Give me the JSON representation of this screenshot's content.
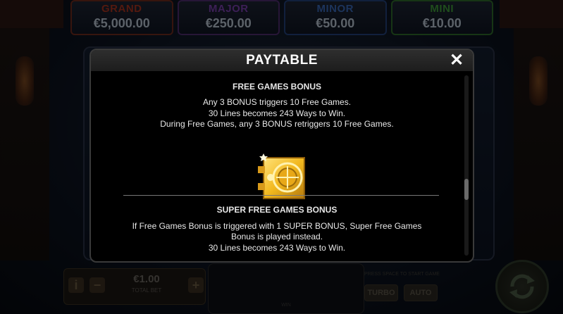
{
  "jackpots": {
    "grand": {
      "name": "GRAND",
      "value": "€5,000.00"
    },
    "major": {
      "name": "MAJOR",
      "value": "€250.00"
    },
    "minor": {
      "name": "MINOR",
      "value": "€50.00"
    },
    "mini": {
      "name": "MINI",
      "value": "€10.00"
    }
  },
  "bottom_bar": {
    "info_symbol": "i",
    "minus_symbol": "−",
    "plus_symbol": "+",
    "bet_value": "€1.00",
    "bet_label": "TOTAL BET",
    "win_label": "WIN",
    "turbo_label": "TURBO",
    "auto_label": "AUTO",
    "spin_hint": "PRESS SPACE TO START GAME"
  },
  "paytable": {
    "title": "PAYTABLE",
    "close_symbol": "✕",
    "free_games": {
      "title": "FREE GAMES BONUS",
      "lines": [
        "Any 3 BONUS triggers 10 Free Games.",
        "30 Lines becomes 243 Ways to Win.",
        "During Free Games, any 3 BONUS retriggers 10 Free Games."
      ],
      "icon": "golden-vault-bonus-icon"
    },
    "super_free_games": {
      "title": "SUPER FREE GAMES BONUS",
      "lines": [
        "If Free Games Bonus is triggered with 1 SUPER BONUS, Super Free Games Bonus is played instead.",
        "30 Lines becomes 243 Ways to Win."
      ]
    },
    "scroll_fraction": 0.65
  },
  "colors": {
    "grand": "#a8331e",
    "major": "#7a3fae",
    "minor": "#3968b8",
    "mini": "#3e9a38",
    "vault_gold": "#f2b81e"
  }
}
